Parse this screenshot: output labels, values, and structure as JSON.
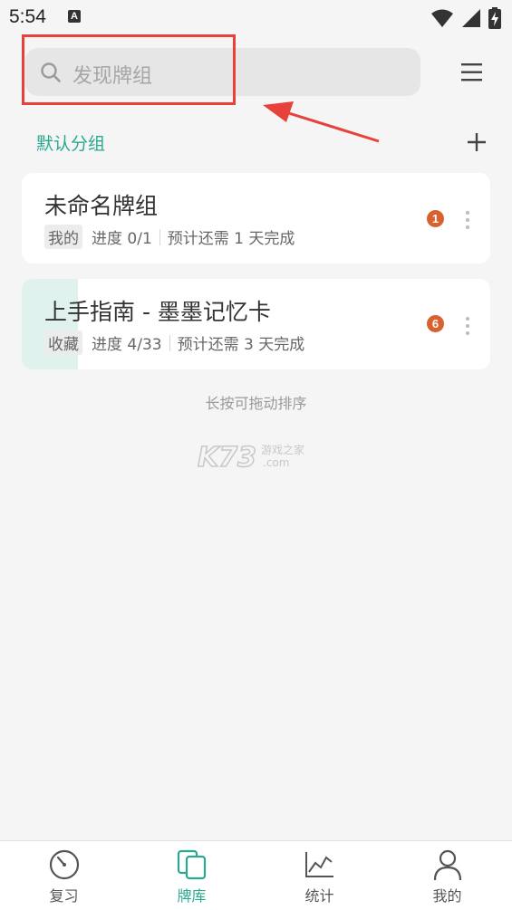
{
  "status_bar": {
    "time": "5:54",
    "notification_icon": "A"
  },
  "search": {
    "placeholder": "发现牌组"
  },
  "section": {
    "title": "默认分组"
  },
  "decks": [
    {
      "title": "未命名牌组",
      "tag": "我的",
      "progress": "进度 0/1",
      "estimate": "预计还需 1 天完成",
      "badge": "1",
      "progress_fraction": 0.0
    },
    {
      "title": "上手指南 - 墨墨记忆卡",
      "tag": "收藏",
      "progress": "进度 4/33",
      "estimate": "预计还需 3 天完成",
      "badge": "6",
      "progress_fraction": 0.121
    }
  ],
  "hint": "长按可拖动排序",
  "watermark": {
    "brand": "K73",
    "line1": "游戏之家",
    "line2": ".com"
  },
  "bottom_nav": [
    {
      "label": "复习",
      "icon": "review-gauge-icon",
      "active": false
    },
    {
      "label": "牌库",
      "icon": "deck-library-icon",
      "active": true
    },
    {
      "label": "统计",
      "icon": "stats-chart-icon",
      "active": false
    },
    {
      "label": "我的",
      "icon": "profile-person-icon",
      "active": false
    }
  ],
  "colors": {
    "accent": "#2aa88f",
    "badge": "#d9602f",
    "annotation": "#e8413c"
  }
}
